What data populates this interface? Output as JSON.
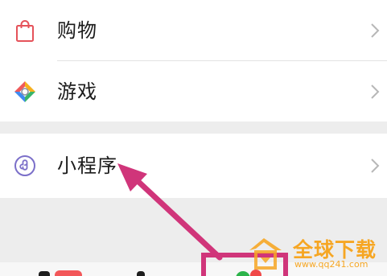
{
  "menu": {
    "items": [
      {
        "label": "购物",
        "icon": "shopping-bag-icon"
      },
      {
        "label": "游戏",
        "icon": "game-diamond-icon"
      },
      {
        "label": "小程序",
        "icon": "mini-program-icon"
      }
    ]
  },
  "annotation": {
    "color": "#d0357a"
  },
  "watermark": {
    "title": "全球下载",
    "url": "www.qq241.com",
    "color": "#f6a623"
  }
}
